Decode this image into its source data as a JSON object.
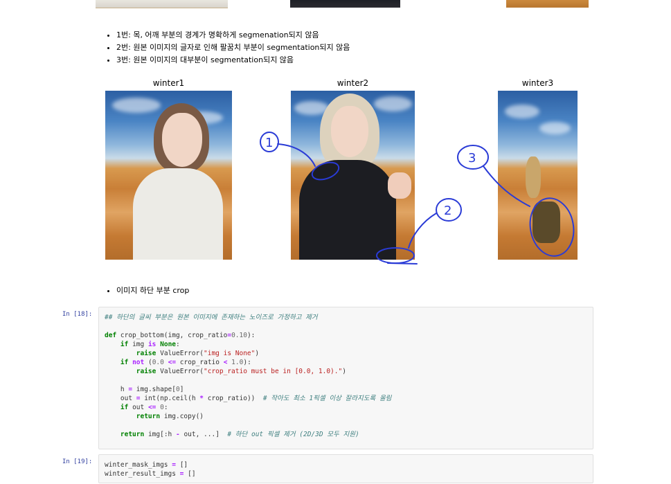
{
  "notes": [
    "1번: 목, 어깨 부분의 경계가 명확하게 segmenation되지 않음",
    "2번: 원본 이미지의 글자로 인해 팔꿈치 부분이 segmentation되지 않음",
    "3번: 원본 이미지의 대부분이 segmentation되지 않음"
  ],
  "figure": {
    "titles": [
      "winter1",
      "winter2",
      "winter3"
    ],
    "annotations": [
      "1",
      "2",
      "3"
    ]
  },
  "crop_note": "이미지 하단 부분 crop",
  "cells": [
    {
      "prompt": "In [18]:",
      "lines": [
        [
          [
            "cm",
            "## 하단의 글씨 부분은 원본 이미지에 존재하는 노이즈로 가정하고 제거"
          ]
        ],
        [
          [
            "",
            ""
          ]
        ],
        [
          [
            "kw",
            "def"
          ],
          [
            "",
            " crop_bottom(img, crop_ratio"
          ],
          [
            "op",
            "="
          ],
          [
            "nu",
            "0.10"
          ],
          [
            "",
            "):"
          ]
        ],
        [
          [
            "",
            "    "
          ],
          [
            "kw",
            "if"
          ],
          [
            "",
            " img "
          ],
          [
            "op",
            "is"
          ],
          [
            "",
            " "
          ],
          [
            "kw",
            "None"
          ],
          [
            "",
            ":"
          ]
        ],
        [
          [
            "",
            "        "
          ],
          [
            "kw",
            "raise"
          ],
          [
            "",
            " ValueError("
          ],
          [
            "st",
            "\"img is None\""
          ],
          [
            "",
            ")"
          ]
        ],
        [
          [
            "",
            "    "
          ],
          [
            "kw",
            "if"
          ],
          [
            "",
            " "
          ],
          [
            "op",
            "not"
          ],
          [
            "",
            " ("
          ],
          [
            "nu",
            "0.0"
          ],
          [
            "",
            " "
          ],
          [
            "op",
            "<="
          ],
          [
            "",
            " crop_ratio "
          ],
          [
            "op",
            "<"
          ],
          [
            "",
            " "
          ],
          [
            "nu",
            "1.0"
          ],
          [
            "",
            "):"
          ]
        ],
        [
          [
            "",
            "        "
          ],
          [
            "kw",
            "raise"
          ],
          [
            "",
            " ValueError("
          ],
          [
            "st",
            "\"crop_ratio must be in [0.0, 1.0).\""
          ],
          [
            "",
            ")"
          ]
        ],
        [
          [
            "",
            ""
          ]
        ],
        [
          [
            "",
            "    h "
          ],
          [
            "op",
            "="
          ],
          [
            "",
            " img.shape["
          ],
          [
            "nu",
            "0"
          ],
          [
            "",
            "]"
          ]
        ],
        [
          [
            "",
            "    out "
          ],
          [
            "op",
            "="
          ],
          [
            "",
            " int(np.ceil(h "
          ],
          [
            "op",
            "*"
          ],
          [
            "",
            " crop_ratio))  "
          ],
          [
            "cm",
            "# 작아도 최소 1픽셀 이상 잘라지도록 올림"
          ]
        ],
        [
          [
            "",
            "    "
          ],
          [
            "kw",
            "if"
          ],
          [
            "",
            " out "
          ],
          [
            "op",
            "<="
          ],
          [
            "",
            " "
          ],
          [
            "nu",
            "0"
          ],
          [
            "",
            ":"
          ]
        ],
        [
          [
            "",
            "        "
          ],
          [
            "kw",
            "return"
          ],
          [
            "",
            " img.copy()"
          ]
        ],
        [
          [
            "",
            ""
          ]
        ],
        [
          [
            "",
            "    "
          ],
          [
            "kw",
            "return"
          ],
          [
            "",
            " img[:h "
          ],
          [
            "op",
            "-"
          ],
          [
            "",
            " out, ...]  "
          ],
          [
            "cm",
            "# 하단 out 픽셀 제거 (2D/3D 모두 지원)"
          ]
        ]
      ]
    },
    {
      "prompt": "In [19]:",
      "lines": [
        [
          [
            "",
            "winter_mask_imgs "
          ],
          [
            "op",
            "="
          ],
          [
            "",
            " []"
          ]
        ],
        [
          [
            "",
            "winter_result_imgs "
          ],
          [
            "op",
            "="
          ],
          [
            "",
            " []"
          ]
        ]
      ]
    }
  ]
}
